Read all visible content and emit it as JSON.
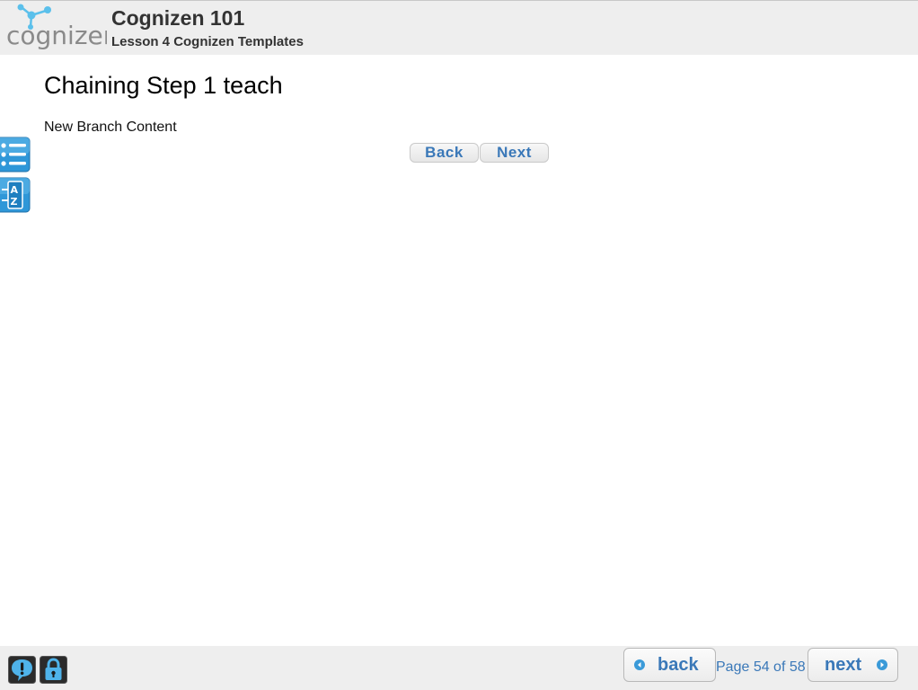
{
  "header": {
    "logo_text": "cognizen",
    "course_title": "Cognizen 101",
    "lesson_title": "Lesson 4 Cognizen Templates"
  },
  "content": {
    "page_title": "Chaining Step 1 teach",
    "body_text": "New Branch Content",
    "branch_back_label": "Back",
    "branch_next_label": "Next"
  },
  "sidebar": {
    "tools": [
      {
        "name": "outline",
        "icon": "list-icon"
      },
      {
        "name": "glossary",
        "icon": "a-z-glossary-icon",
        "letters": "AZ"
      }
    ]
  },
  "footer": {
    "tools": [
      {
        "name": "help",
        "icon": "help-bubble-icon"
      },
      {
        "name": "lock",
        "icon": "lock-icon"
      }
    ],
    "back_label": "back",
    "next_label": "next",
    "page_counter": "Page 54 of 58"
  },
  "colors": {
    "accent_blue": "#3a78b8",
    "header_bg": "#eeeeee",
    "icon_blue": "#2f97d8",
    "logo_cyan": "#5bc0eb",
    "logo_gray": "#8a8a8a"
  }
}
